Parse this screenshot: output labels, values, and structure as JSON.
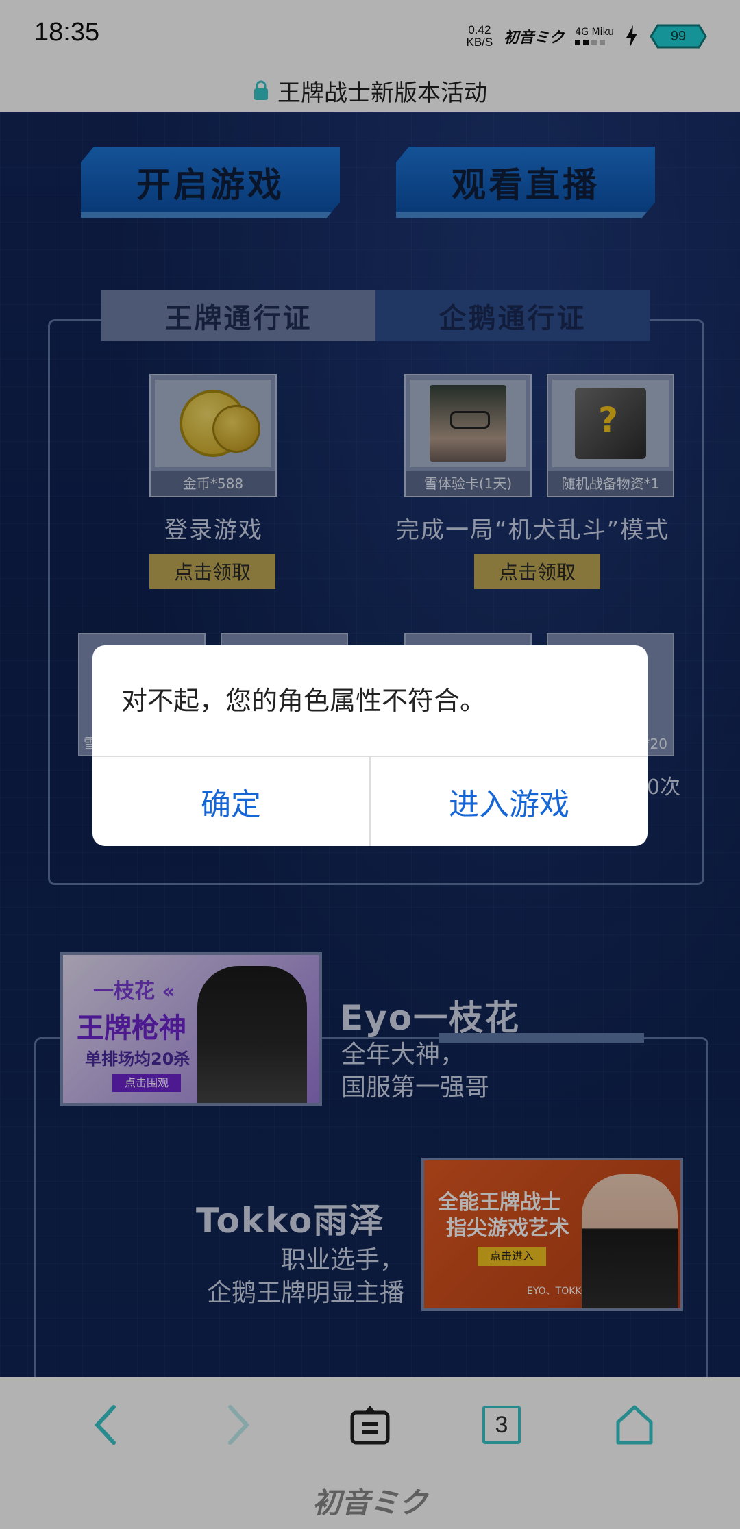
{
  "status_bar": {
    "time": "18:35",
    "net_speed_value": "0.42",
    "net_speed_unit": "KB/S",
    "brand": "初音ミク",
    "network_type": "4G",
    "network_tag": "Miku",
    "battery_level": "99"
  },
  "url_bar": {
    "title": "王牌战士新版本活动"
  },
  "actions": {
    "start_game": "开启游戏",
    "watch_live": "观看直播"
  },
  "pass": {
    "tabs": [
      {
        "label": "王牌通行证",
        "active": true
      },
      {
        "label": "企鹅通行证",
        "active": false
      }
    ],
    "rewards": [
      {
        "caption": "金币*588",
        "icon": "gold-coin-icon"
      },
      {
        "caption": "雪体验卡(1天)",
        "icon": "character-portrait"
      },
      {
        "caption": "随机战备物资*1",
        "icon": "supply-box-icon"
      }
    ],
    "tasks": [
      {
        "label": "登录游戏",
        "claim": "点击领取"
      },
      {
        "label": "完成一局“机犬乱斗”模式",
        "claim": "点击领取"
      }
    ],
    "row2_peek_left": "雪",
    "row2_peek_caption": "*20",
    "row2_peek_text": "0次"
  },
  "dialog": {
    "message": "对不起，您的角色属性不符合。",
    "confirm": "确定",
    "enter_game": "进入游戏"
  },
  "streamers": [
    {
      "name": "Eyo一枝花",
      "desc_line1": "全年大神，",
      "desc_line2": "国服第一强哥",
      "banner_line1": "一枝花 «",
      "banner_line2": "王牌枪神",
      "banner_line3": "单排场均20杀",
      "banner_button": "点击围观"
    },
    {
      "name": "Tokko雨泽",
      "desc_line1": "职业选手，",
      "desc_line2": "企鹅王牌明显主播",
      "banner_line1": "全能王牌战士",
      "banner_line2": "指尖游戏艺术",
      "banner_button": "点击进入",
      "banner_footer": "EYO、TOKKO雨泽"
    }
  ],
  "bottom_nav": {
    "tab_count": "3",
    "brand": "初音ミク",
    "accent": "#39c6c9"
  }
}
